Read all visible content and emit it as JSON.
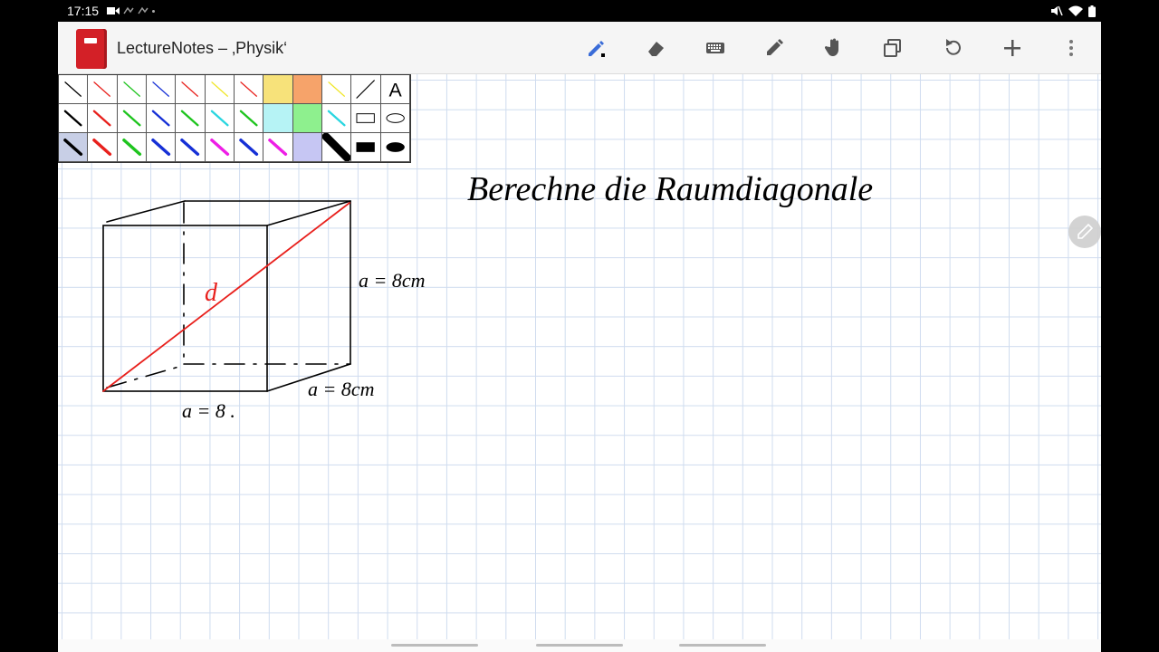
{
  "status": {
    "time": "17:15"
  },
  "app": {
    "title": "LectureNotes – ‚Physik‘"
  },
  "toolbar": {
    "tools": [
      {
        "name": "pen-icon"
      },
      {
        "name": "eraser-icon"
      },
      {
        "name": "keyboard-icon"
      },
      {
        "name": "highlighter-icon"
      },
      {
        "name": "hand-icon"
      },
      {
        "name": "copy-icon"
      },
      {
        "name": "undo-icon"
      },
      {
        "name": "add-icon"
      },
      {
        "name": "more-icon"
      }
    ]
  },
  "palette": {
    "text_tool_label": "A",
    "colors": {
      "black": "#000000",
      "red": "#e8201c",
      "green": "#1ec41e",
      "blue": "#1630d6",
      "yellow": "#f0e628",
      "cyan": "#2ad6e0",
      "magenta": "#ee1ee6",
      "highlight_yellow": "#f7e27a",
      "highlight_orange": "#f6a36a",
      "highlight_cyan": "#b6f3f5",
      "highlight_green": "#8ef08e",
      "highlight_lavender": "#c6c6f3"
    }
  },
  "note": {
    "heading": "Berechne die Raumdiagonale",
    "label_d": "d",
    "label_height": "a = 8cm",
    "label_depth": "a = 8cm",
    "label_width": "a = 8 ."
  }
}
